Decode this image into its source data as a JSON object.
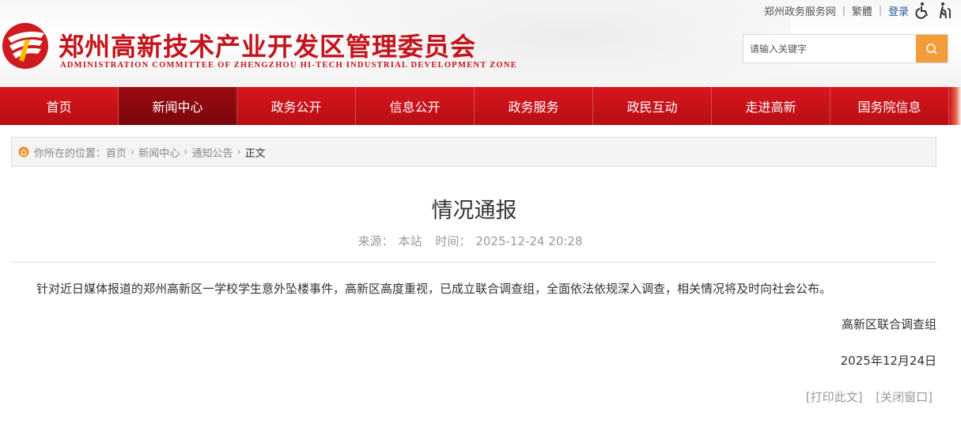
{
  "header": {
    "title": "郑州高新技术产业开发区管理委员会",
    "subtitle": "ADMINISTRATION COMMITTEE OF ZHENGZHOU HI-TECH INDUSTRIAL DEVELOPMENT ZONE",
    "toplinks": {
      "gov_service": "郑州政务服务网",
      "traditional": "繁體",
      "login": "登录",
      "accessibility_icon": "wheelchair-icon",
      "elder_icon": "elderly-icon"
    },
    "search": {
      "placeholder": "请输入关键字",
      "icon": "search-icon"
    }
  },
  "nav": {
    "items": [
      {
        "label": "首页"
      },
      {
        "label": "新闻中心",
        "active": true
      },
      {
        "label": "政务公开"
      },
      {
        "label": "信息公开"
      },
      {
        "label": "政务服务"
      },
      {
        "label": "政民互动"
      },
      {
        "label": "走进高新"
      },
      {
        "label": "国务院信息"
      }
    ]
  },
  "breadcrumb": {
    "prefix": "你所在的位置：",
    "items": [
      "首页",
      "新闻中心",
      "通知公告"
    ],
    "current": "正文",
    "separator": "›"
  },
  "article": {
    "title": "情况通报",
    "source_label": "来源：",
    "source": "本站",
    "time_label": "时间：",
    "time": "2025-12-24 20:28",
    "body": "针对近日媒体报道的郑州高新区一学校学生意外坠楼事件，高新区高度重视，已成立联合调查组，全面依法依规深入调查，相关情况将及时向社会公布。",
    "signature": "高新区联合调查组",
    "date": "2025年12月24日"
  },
  "actions": {
    "print": "[打印此文]",
    "close": "[关闭窗口]"
  },
  "colors": {
    "brand_red": "#c4131b",
    "nav_red": "#d8161e",
    "search_orange": "#f39c3a",
    "login_blue": "#2b5aa3"
  }
}
